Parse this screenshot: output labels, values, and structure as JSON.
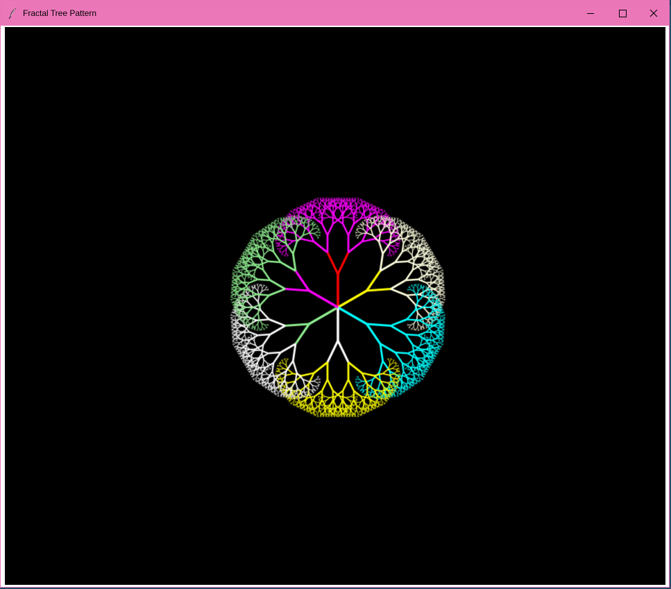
{
  "window": {
    "title": "Fractal Tree Pattern",
    "titlebar_color": "#eb77b9",
    "icon": "feather-icon",
    "controls": {
      "minimize_icon": "minimize-icon",
      "maximize_icon": "maximize-icon",
      "close_icon": "close-icon"
    }
  },
  "canvas": {
    "background": "#000000",
    "tree_count": 6,
    "tree_colors": [
      "#ff00ff",
      "#ffffe0",
      "#00ffff",
      "#ffff00",
      "#ffffff",
      "#90ee90"
    ],
    "trunk_colors": [
      "#ff0000",
      "#ffff00",
      "#00ffff",
      "#ffffff",
      "#90ee90",
      "#ff00ff"
    ]
  }
}
